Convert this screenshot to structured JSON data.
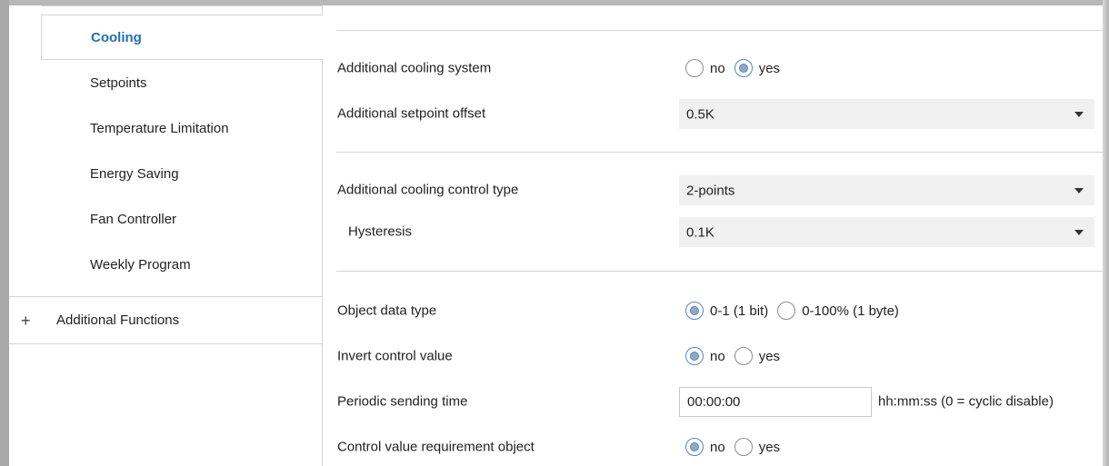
{
  "sidebar": {
    "items": [
      {
        "label": "Cooling",
        "active": true
      },
      {
        "label": "Setpoints"
      },
      {
        "label": "Temperature Limitation"
      },
      {
        "label": "Energy Saving"
      },
      {
        "label": "Fan Controller"
      },
      {
        "label": "Weekly Program"
      }
    ],
    "group": {
      "icon": "plus-icon",
      "symbol": "+",
      "label": "Additional Functions"
    }
  },
  "params": {
    "additional_cooling_system": {
      "label": "Additional cooling system",
      "options": [
        "no",
        "yes"
      ],
      "selected": "yes"
    },
    "additional_setpoint_offset": {
      "label": "Additional setpoint offset",
      "value": "0.5K"
    },
    "additional_cooling_control_type": {
      "label": "Additional cooling control type",
      "value": "2-points"
    },
    "hysteresis": {
      "label": "Hysteresis",
      "value": "0.1K"
    },
    "object_data_type": {
      "label": "Object data type",
      "options": [
        "0-1 (1 bit)",
        "0-100% (1 byte)"
      ],
      "selected": "0-1 (1 bit)"
    },
    "invert_control_value": {
      "label": "Invert control value",
      "options": [
        "no",
        "yes"
      ],
      "selected": "no"
    },
    "periodic_sending_time": {
      "label": "Periodic sending time",
      "value": "00:00:00",
      "unit": "hh:mm:ss (0 = cyclic disable)"
    },
    "control_value_requirement_object": {
      "label": "Control value requirement object",
      "options": [
        "no",
        "yes"
      ],
      "selected": "no"
    }
  },
  "colors": {
    "accent": "#1f6fb5",
    "radio_fill": "#8fa9c7",
    "select_bg": "#f0f0f0"
  }
}
